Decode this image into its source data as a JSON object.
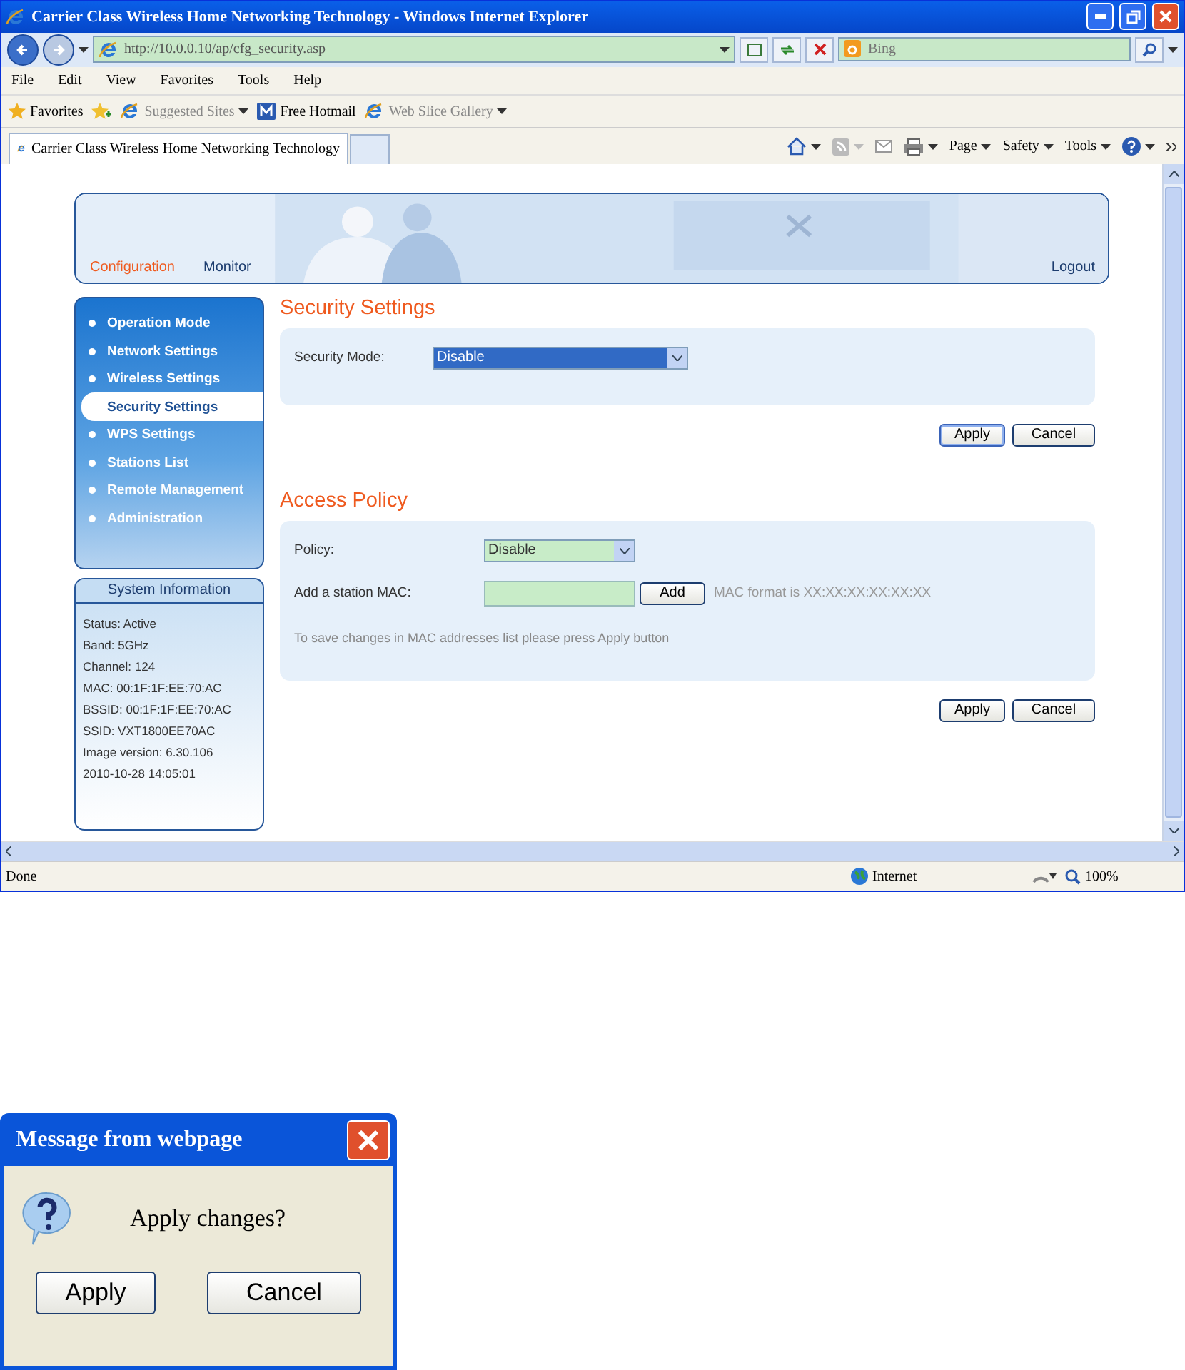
{
  "window": {
    "title": "Carrier Class Wireless Home Networking Technology - Windows Internet Explorer"
  },
  "address_bar": {
    "url": "http://10.0.0.10/ap/cfg_security.asp",
    "search_placeholder": "Bing"
  },
  "menu": [
    "File",
    "Edit",
    "View",
    "Favorites",
    "Tools",
    "Help"
  ],
  "favorites_bar": {
    "label": "Favorites",
    "links": [
      "Suggested Sites",
      "Free Hotmail",
      "Web Slice Gallery"
    ]
  },
  "tab": {
    "title": "Carrier Class Wireless Home Networking Technology"
  },
  "command_bar": [
    "Page",
    "Safety",
    "Tools"
  ],
  "header": {
    "nav": [
      {
        "label": "Configuration",
        "selected": true
      },
      {
        "label": "Monitor",
        "selected": false
      }
    ],
    "logout": "Logout"
  },
  "sidebar": {
    "items": [
      {
        "label": "Operation Mode",
        "selected": false
      },
      {
        "label": "Network Settings",
        "selected": false
      },
      {
        "label": "Wireless Settings",
        "selected": false
      },
      {
        "label": "Security Settings",
        "selected": true
      },
      {
        "label": "WPS Settings",
        "selected": false
      },
      {
        "label": "Stations List",
        "selected": false
      },
      {
        "label": "Remote Management",
        "selected": false
      },
      {
        "label": "Administration",
        "selected": false
      }
    ]
  },
  "system_info": {
    "title": "System Information",
    "lines": [
      "Status: Active",
      "Band: 5GHz",
      "Channel: 124",
      "MAC: 00:1F:1F:EE:70:AC",
      "BSSID: 00:1F:1F:EE:70:AC",
      "SSID: VXT1800EE70AC",
      "Image version: 6.30.106",
      "2010-10-28 14:05:01"
    ]
  },
  "security": {
    "title": "Security Settings",
    "mode_label": "Security Mode:",
    "mode_value": "Disable",
    "buttons": [
      "Apply",
      "Cancel"
    ]
  },
  "access_policy": {
    "title": "Access Policy",
    "policy_label": "Policy:",
    "policy_value": "Disable",
    "mac_label": "Add a station MAC:",
    "add_button": "Add",
    "mac_hint": "MAC format is XX:XX:XX:XX:XX:XX",
    "note": "To save changes in MAC addresses list please press Apply button",
    "buttons": [
      "Apply",
      "Cancel"
    ]
  },
  "status_bar": {
    "status": "Done",
    "zone": "Internet",
    "zoom": "100%"
  },
  "dialog": {
    "title": "Message from webpage",
    "message": "Apply changes?",
    "buttons": [
      "Apply",
      "Cancel"
    ]
  }
}
